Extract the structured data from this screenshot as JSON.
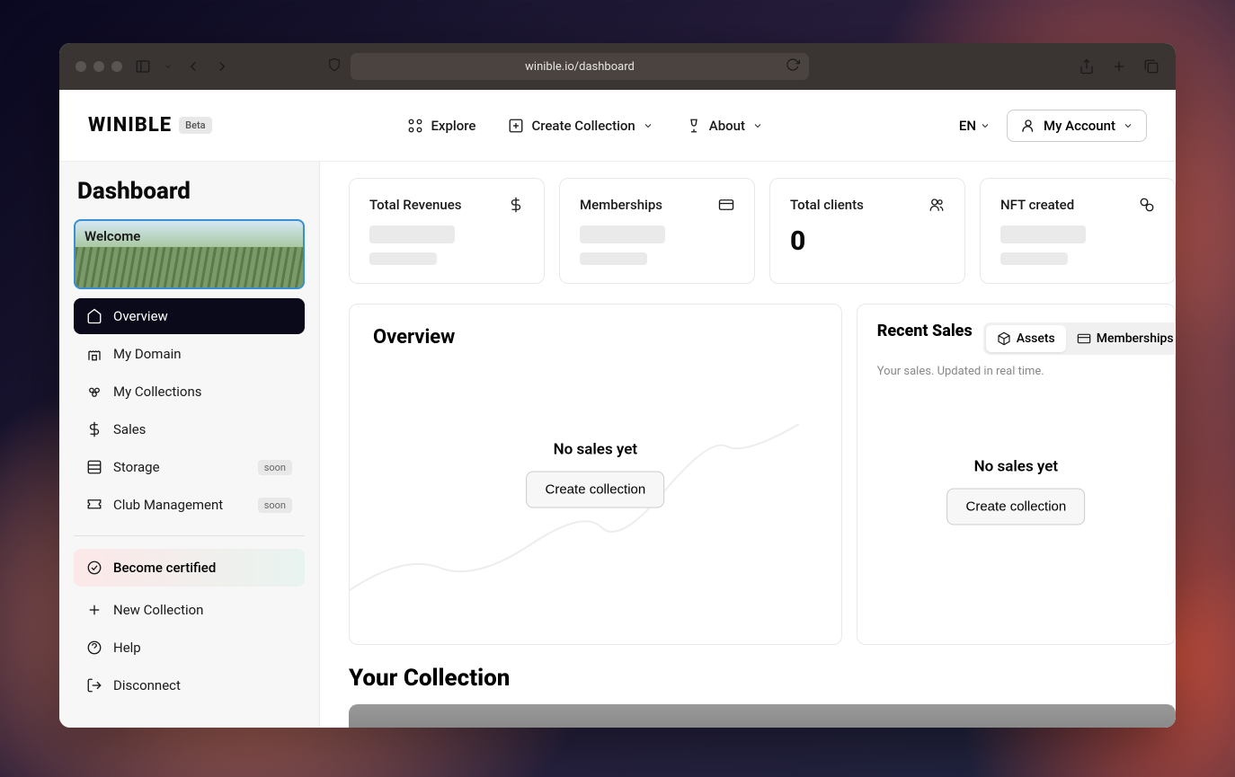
{
  "browser": {
    "url": "winible.io/dashboard"
  },
  "brand": {
    "name": "WINIBLE",
    "badge": "Beta"
  },
  "nav": {
    "explore": "Explore",
    "create": "Create Collection",
    "about": "About",
    "lang": "EN",
    "account": "My Account"
  },
  "sidebar": {
    "title": "Dashboard",
    "welcome": "Welcome",
    "items": {
      "overview": "Overview",
      "domain": "My Domain",
      "collections": "My Collections",
      "sales": "Sales",
      "storage": "Storage",
      "club": "Club Management"
    },
    "soon": "soon",
    "certified": "Become certified",
    "newcol": "New Collection",
    "help": "Help",
    "disconnect": "Disconnect"
  },
  "stats": {
    "revenues": "Total Revenues",
    "memberships": "Memberships",
    "clients": "Total clients",
    "clients_value": "0",
    "nft": "NFT created"
  },
  "overview": {
    "title": "Overview",
    "empty": "No sales yet",
    "cta": "Create collection"
  },
  "sales": {
    "title": "Recent Sales",
    "sub": "Your sales. Updated in real time.",
    "tab_assets": "Assets",
    "tab_memberships": "Memberships",
    "empty": "No sales yet",
    "cta": "Create collection"
  },
  "collection": {
    "title": "Your Collection"
  }
}
